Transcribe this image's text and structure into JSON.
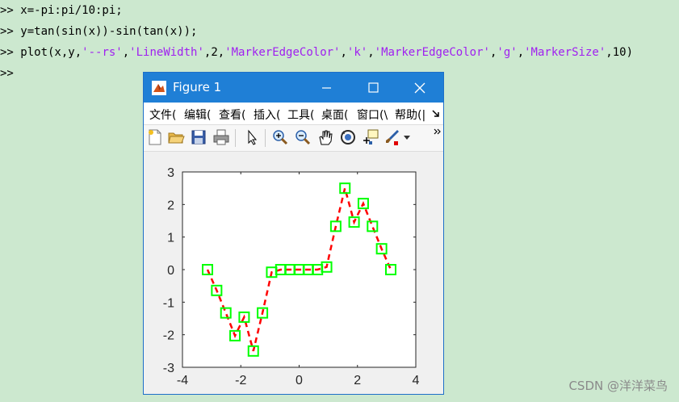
{
  "command_window": {
    "lines": [
      {
        "prompt": ">>",
        "parts": [
          {
            "text": " x=-pi:pi/10:pi;",
            "kind": "code"
          }
        ]
      },
      {
        "prompt": ">>",
        "parts": [
          {
            "text": " y=tan(sin(x))-sin(tan(x));",
            "kind": "code"
          }
        ]
      },
      {
        "prompt": ">>",
        "parts": [
          {
            "text": " plot(x,y,",
            "kind": "code"
          },
          {
            "text": "'--rs'",
            "kind": "str"
          },
          {
            "text": ",",
            "kind": "code"
          },
          {
            "text": "'LineWidth'",
            "kind": "str"
          },
          {
            "text": ",2,",
            "kind": "code"
          },
          {
            "text": "'MarkerEdgeColor'",
            "kind": "str"
          },
          {
            "text": ",",
            "kind": "code"
          },
          {
            "text": "'k'",
            "kind": "str"
          },
          {
            "text": ",",
            "kind": "code"
          },
          {
            "text": "'MarkerEdgeColor'",
            "kind": "str"
          },
          {
            "text": ",",
            "kind": "code"
          },
          {
            "text": "'g'",
            "kind": "str"
          },
          {
            "text": ",",
            "kind": "code"
          },
          {
            "text": "'MarkerSize'",
            "kind": "str"
          },
          {
            "text": ",10)",
            "kind": "code"
          }
        ]
      },
      {
        "prompt": ">>",
        "parts": []
      }
    ]
  },
  "watermark": "CSDN @洋洋菜鸟",
  "figure": {
    "title": "Figure 1",
    "menu": [
      "文件(",
      "编辑(",
      "查看(",
      "插入(",
      "工具(",
      "桌面(",
      "窗口(\\",
      "帮助(|"
    ],
    "toolbar_icons": [
      "new-figure-icon",
      "open-file-icon",
      "save-icon",
      "print-icon",
      "pointer-icon",
      "zoom-in-icon",
      "zoom-out-icon",
      "pan-icon",
      "rotate-3d-icon",
      "data-cursor-icon",
      "brush-icon"
    ],
    "colors": {
      "titlebar": "#1f7fd6",
      "line": "#ff0000",
      "marker": "#00ff00"
    }
  },
  "chart_data": {
    "type": "line",
    "line_style": "dashed",
    "marker": "square",
    "x": [
      -3.1416,
      -2.8274,
      -2.5133,
      -2.1991,
      -1.885,
      -1.5708,
      -1.2566,
      -0.9425,
      -0.6283,
      -0.3142,
      0,
      0.3142,
      0.6283,
      0.9425,
      1.2566,
      1.5708,
      1.885,
      2.1991,
      2.5133,
      2.8274,
      3.1416
    ],
    "y": [
      0.0,
      -0.64,
      -1.33,
      -2.03,
      -1.46,
      -2.5,
      -1.33,
      -0.08,
      0.0,
      0.0,
      0.0,
      0.0,
      0.0,
      0.08,
      1.33,
      2.5,
      1.46,
      2.03,
      1.33,
      0.64,
      0.0
    ],
    "xlim": [
      -4,
      4
    ],
    "ylim": [
      -3,
      3
    ],
    "xticks": [
      "-4",
      "-2",
      "0",
      "2",
      "4"
    ],
    "yticks": [
      "3",
      "2",
      "1",
      "0",
      "-1",
      "-2",
      "-3"
    ],
    "grid": false
  }
}
